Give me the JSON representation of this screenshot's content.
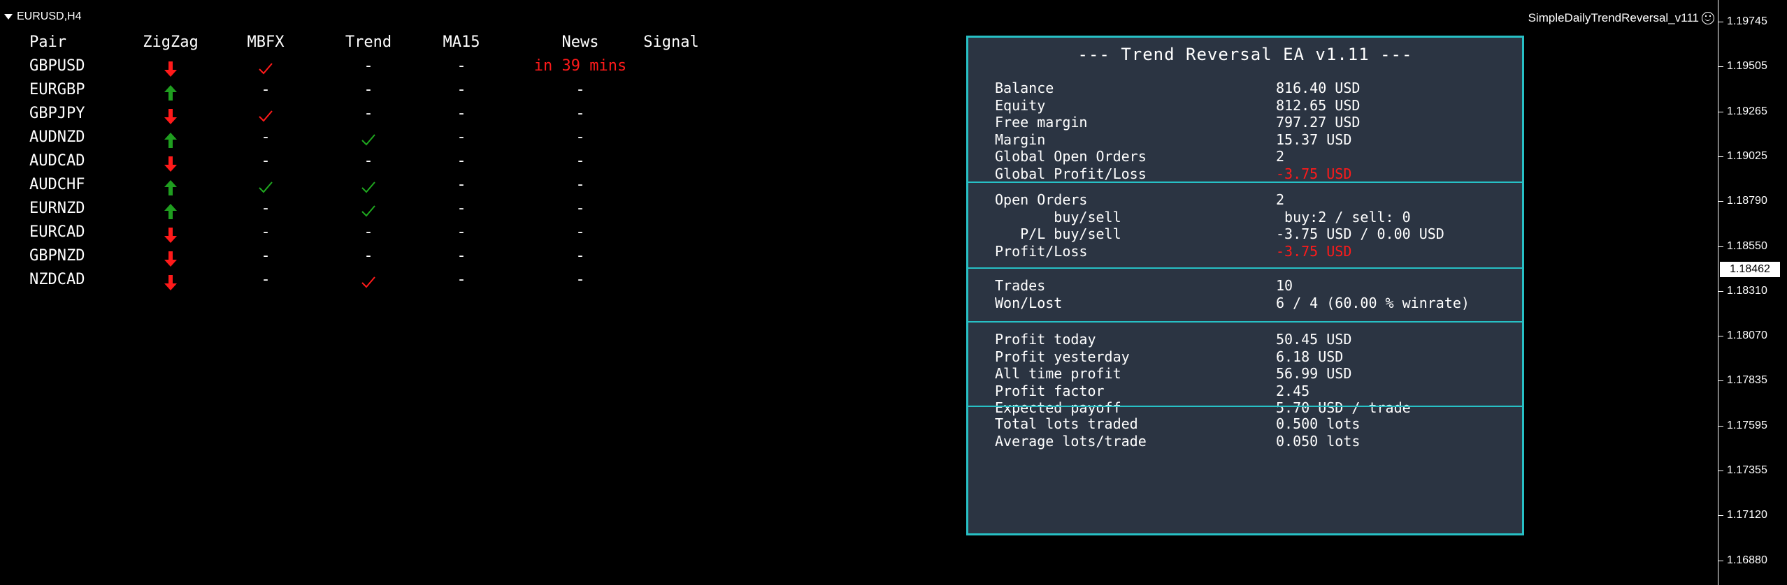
{
  "chart": {
    "symbol_timeframe": "EURUSD,H4",
    "ea_name": "SimpleDailyTrendReversal_v111"
  },
  "price_axis": {
    "ticks": [
      "1.19745",
      "1.19505",
      "1.19265",
      "1.19025",
      "1.18790",
      "1.18550",
      "1.18310",
      "1.18070",
      "1.17835",
      "1.17595",
      "1.17355",
      "1.17120",
      "1.16880"
    ],
    "current_price": "1.18462"
  },
  "dashboard": {
    "headers": {
      "pair": "Pair",
      "zigzag": "ZigZag",
      "mbfx": "MBFX",
      "trend": "Trend",
      "ma15": "MA15",
      "news": "News",
      "signal": "Signal"
    },
    "rows": [
      {
        "pair": "GBPUSD",
        "zigzag": "down",
        "mbfx": "check-red",
        "trend": "-",
        "ma15": "-",
        "news": "in 39 mins",
        "signal": ""
      },
      {
        "pair": "EURGBP",
        "zigzag": "up",
        "mbfx": "-",
        "trend": "-",
        "ma15": "-",
        "news": "-",
        "signal": ""
      },
      {
        "pair": "GBPJPY",
        "zigzag": "down",
        "mbfx": "check-red",
        "trend": "-",
        "ma15": "-",
        "news": "-",
        "signal": ""
      },
      {
        "pair": "AUDNZD",
        "zigzag": "up",
        "mbfx": "-",
        "trend": "check-green",
        "ma15": "-",
        "news": "-",
        "signal": ""
      },
      {
        "pair": "AUDCAD",
        "zigzag": "down",
        "mbfx": "-",
        "trend": "-",
        "ma15": "-",
        "news": "-",
        "signal": ""
      },
      {
        "pair": "AUDCHF",
        "zigzag": "up",
        "mbfx": "check-green",
        "trend": "check-green",
        "ma15": "-",
        "news": "-",
        "signal": ""
      },
      {
        "pair": "EURNZD",
        "zigzag": "up",
        "mbfx": "-",
        "trend": "check-green",
        "ma15": "-",
        "news": "-",
        "signal": ""
      },
      {
        "pair": "EURCAD",
        "zigzag": "down",
        "mbfx": "-",
        "trend": "-",
        "ma15": "-",
        "news": "-",
        "signal": ""
      },
      {
        "pair": "GBPNZD",
        "zigzag": "down",
        "mbfx": "-",
        "trend": "-",
        "ma15": "-",
        "news": "-",
        "signal": ""
      },
      {
        "pair": "NZDCAD",
        "zigzag": "down",
        "mbfx": "-",
        "trend": "check-red",
        "ma15": "-",
        "news": "-",
        "signal": ""
      }
    ]
  },
  "panel": {
    "title": "--- Trend Reversal EA v1.11 ---",
    "sections": [
      [
        {
          "k": "Balance",
          "v": "816.40 USD"
        },
        {
          "k": "Equity",
          "v": "812.65 USD"
        },
        {
          "k": "Free margin",
          "v": "797.27 USD"
        },
        {
          "k": "Margin",
          "v": "15.37 USD"
        },
        {
          "k": "Global Open Orders",
          "v": "2"
        },
        {
          "k": "Global Profit/Loss",
          "v": "-3.75 USD",
          "neg": true
        }
      ],
      [
        {
          "k": "Open Orders",
          "v": "2"
        },
        {
          "k": "       buy/sell",
          "v": " buy:2 / sell: 0"
        },
        {
          "k": "   P/L buy/sell",
          "v": "-3.75 USD / 0.00 USD"
        },
        {
          "k": "Profit/Loss",
          "v": "-3.75 USD",
          "neg": true
        }
      ],
      [
        {
          "k": "Trades",
          "v": "10"
        },
        {
          "k": "Won/Lost",
          "v": "6 / 4 (60.00 % winrate)"
        }
      ],
      [
        {
          "k": "Profit today",
          "v": "50.45 USD"
        },
        {
          "k": "Profit yesterday",
          "v": "6.18 USD"
        },
        {
          "k": "All time profit",
          "v": "56.99 USD"
        },
        {
          "k": "Profit factor",
          "v": "2.45"
        },
        {
          "k": "Expected payoff",
          "v": "5.70 USD / trade"
        }
      ],
      [
        {
          "k": "Total lots traded",
          "v": "0.500 lots"
        },
        {
          "k": "Average lots/trade",
          "v": "0.050 lots"
        }
      ]
    ]
  },
  "colors": {
    "up": "#1f9e1f",
    "down": "#ff1a1a",
    "check_green": "#1fa81f",
    "check_red": "#ff1a1a",
    "panel_border": "#27c0c5",
    "panel_bg": "#2b3442"
  }
}
